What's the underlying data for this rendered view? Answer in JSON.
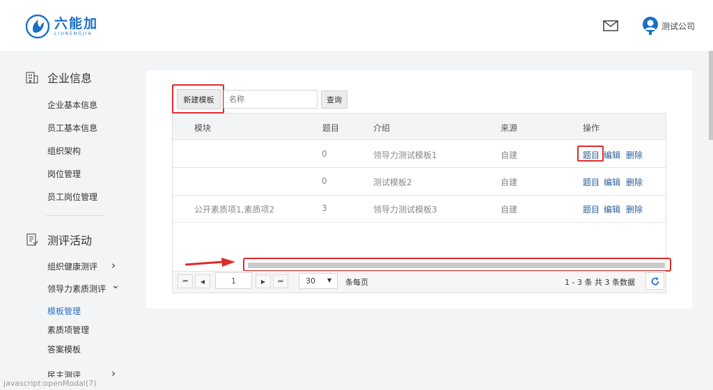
{
  "header": {
    "logo_text": "六能加",
    "logo_sub": "LIUNENGJIA",
    "user_name": "测试公司"
  },
  "sidebar": {
    "enterprise": {
      "title": "企业信息",
      "items": [
        "企业基本信息",
        "员工基本信息",
        "组织架构",
        "岗位管理",
        "员工岗位管理"
      ]
    },
    "assessment": {
      "title": "测评活动",
      "groups": [
        {
          "label": "组织健康测评",
          "chevron": "›"
        },
        {
          "label": "领导力素质测评",
          "chevron": "⌄"
        }
      ],
      "subitems": [
        "模板管理",
        "素质项管理",
        "答案模板"
      ],
      "active": "模板管理",
      "last_group": {
        "label": "民主测评",
        "chevron": "›"
      }
    }
  },
  "toolbar": {
    "new_button": "新建模板",
    "name_placeholder": "名称",
    "query_button": "查询"
  },
  "table": {
    "headers": [
      "模块",
      "题目",
      "介绍",
      "来源",
      "操作"
    ],
    "rows": [
      {
        "module": "",
        "questions": "0",
        "intro": "领导力测试模板1",
        "source": "自建"
      },
      {
        "module": "",
        "questions": "0",
        "intro": "测试模板2",
        "source": "自建"
      },
      {
        "module": "公开素质项1,素质项2",
        "questions": "3",
        "intro": "领导力测试模板3",
        "source": "自建"
      }
    ],
    "actions": [
      "题目",
      "编辑",
      "删除"
    ]
  },
  "pager": {
    "first": "⏮",
    "prev": "◀",
    "next": "▶",
    "last": "⏭",
    "page": "1",
    "page_size": "30",
    "per_page_label": "条每页",
    "range": "1 - 3 条   共 3 条数据"
  },
  "status_url": "javascript:openModal(7)",
  "colors": {
    "brand": "#1a6ec8",
    "link": "#2a5d9c",
    "active": "#2a72c9",
    "highlight": "#e02a2a"
  }
}
